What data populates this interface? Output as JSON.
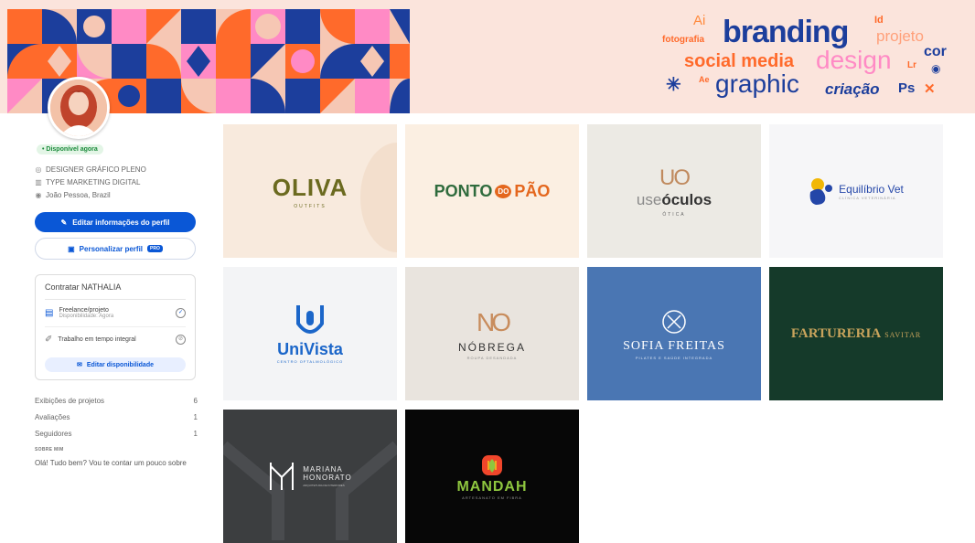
{
  "banner": {
    "wordcloud": {
      "ai": "Ai",
      "id": "Id",
      "fotografia": "fotografia",
      "branding": "branding",
      "projeto": "projeto",
      "social_media": "social media",
      "design": "design",
      "cor": "cor",
      "lr": "Lr",
      "ae": "Ae",
      "graphic": "graphic",
      "criacao": "criação",
      "ps": "Ps"
    }
  },
  "profile": {
    "status_badge": "• Disponível agora",
    "role": "DESIGNER GRÁFICO PLENO",
    "company": "TYPE MARKETING DIGITAL",
    "location": "João Pessoa, Brazil",
    "edit_button": "Editar informações do perfil",
    "customize_button": "Personalizar perfil",
    "pro_badge": "PRO"
  },
  "hire": {
    "title": "Contratar NATHALIA",
    "freelance_label": "Freelance/projeto",
    "freelance_sub": "Disponibilidade: Agora",
    "fulltime_label": "Trabalho em tempo integral",
    "availability_button": "Editar disponibilidade"
  },
  "stats": [
    {
      "label": "Exibições de projetos",
      "value": "6"
    },
    {
      "label": "Avaliações",
      "value": "1"
    },
    {
      "label": "Seguidores",
      "value": "1"
    }
  ],
  "about": {
    "heading": "SOBRE MIM",
    "text": "Olá! Tudo bem? Vou te contar um pouco sobre"
  },
  "projects": [
    {
      "name": "OLIVA",
      "sub": "OUTFITS"
    },
    {
      "name_a": "PONTO",
      "name_mid": "DO",
      "name_b": "PÃO"
    },
    {
      "mark": "UO",
      "name_a": "use",
      "name_b": "óculos",
      "sub": "ÓTICA"
    },
    {
      "name": "Equilíbrio Vet",
      "sub": "CLÍNICA VETERINÁRIA"
    },
    {
      "name": "UniVista",
      "sub": "CENTRO OFTALMOLÓGICO"
    },
    {
      "mark": "NO",
      "name": "NÓBREGA",
      "sub": "ROUPA DESANDADA"
    },
    {
      "name": "SOFIA FREITAS",
      "sub": "PILATES E SAÚDE INTEGRADA"
    },
    {
      "name_a": "FARTURERIA",
      "name_b": "SAVITAR"
    },
    {
      "name_a": "MARIANA",
      "name_b": "HONORATO",
      "sub": "ARQUITETURA DE INTERIORES"
    },
    {
      "name": "MANDAH",
      "sub": "ARTESANATO EM FIBRA"
    }
  ],
  "colors": {
    "accent": "#0a57d6",
    "available": "#1a8a3a"
  }
}
